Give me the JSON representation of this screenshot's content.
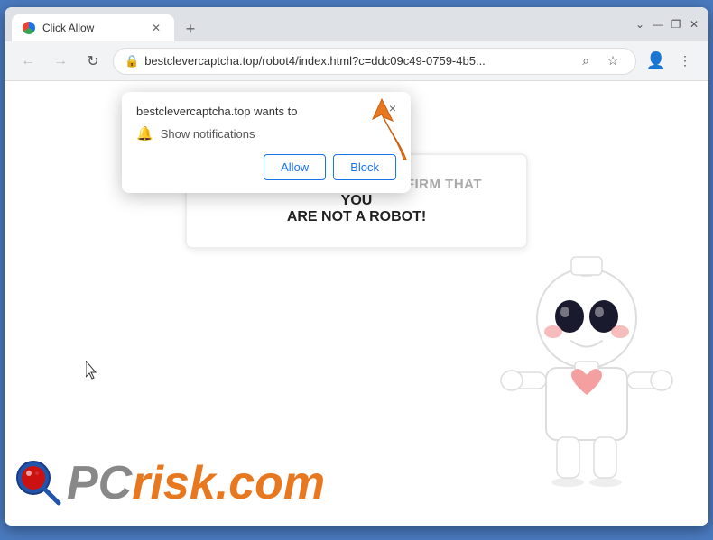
{
  "window": {
    "border_color": "#4a7abf"
  },
  "titlebar": {
    "tab_title": "Click Allow",
    "new_tab_label": "+",
    "chevron_down": "⌄",
    "minimize": "—",
    "restore": "❐",
    "close": "✕"
  },
  "addressbar": {
    "back_arrow": "←",
    "forward_arrow": "→",
    "reload": "↻",
    "lock_icon": "🔒",
    "url": "bestclevercaptcha.top/robot4/index.html?c=ddc09c49-0759-4b5...",
    "search_icon": "⌕",
    "star_icon": "☆",
    "profile_icon": "⊙",
    "menu_icon": "⋮"
  },
  "notification_popup": {
    "site": "bestclevercaptcha.top wants to",
    "permission": "Show notifications",
    "allow_button": "Allow",
    "block_button": "Block",
    "close_icon": "×"
  },
  "page": {
    "captcha_line1": "CLICK «ALLOW» TO CONFIRM THAT YOU",
    "captcha_line2": "ARE NOT A ROBOT!",
    "captcha_gray_part": "CLICK «ALLOW» TO CONFIRM THAT ",
    "captcha_bold_part": "YOU ARE NOT A ROBOT!"
  },
  "pcrisk": {
    "text_gray": "PC",
    "text_orange": "risk.com"
  }
}
